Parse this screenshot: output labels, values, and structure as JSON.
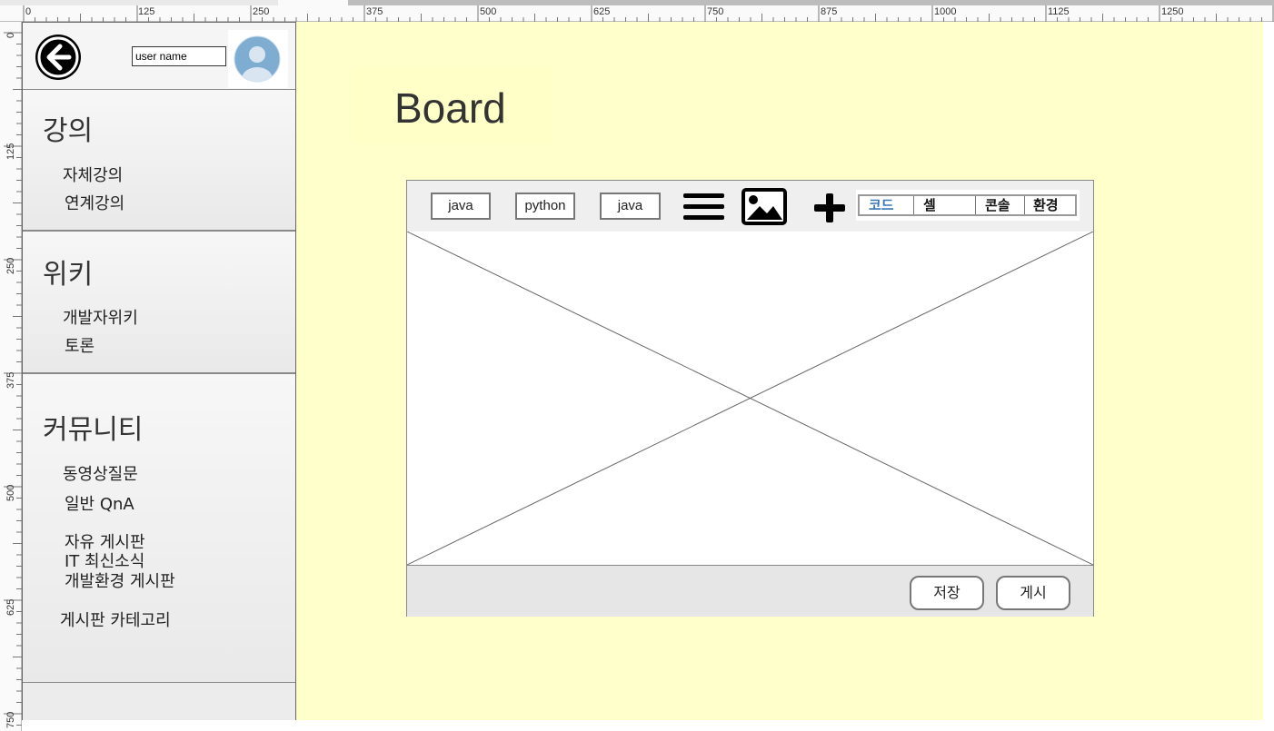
{
  "ruler": {
    "top_labels": [
      "0",
      "125",
      "250",
      "375",
      "500",
      "625",
      "750",
      "875",
      "1000",
      "1125",
      "1250"
    ],
    "left_labels": [
      "0",
      "125",
      "250",
      "375",
      "500",
      "625",
      "750"
    ]
  },
  "sidebar": {
    "user_name": "user name",
    "sections": [
      {
        "title": "강의",
        "items": [
          "자체강의",
          "연계강의"
        ]
      },
      {
        "title": "위키",
        "items": [
          "개발자위키",
          "토론"
        ]
      },
      {
        "title": "커뮤니티",
        "items": [
          "동영상질문",
          "일반 QnA",
          "자유 게시판",
          "IT 최신소식",
          "개발환경 게시판",
          "게시판 카테고리"
        ]
      }
    ]
  },
  "board": {
    "title": "Board",
    "toolbar": {
      "tags": [
        "java",
        "python",
        "java"
      ],
      "tabs": [
        "코드",
        "셀",
        "콘솔",
        "환경"
      ],
      "active_tab": "코드"
    },
    "actions": {
      "save_label": "저장",
      "post_label": "게시"
    }
  }
}
